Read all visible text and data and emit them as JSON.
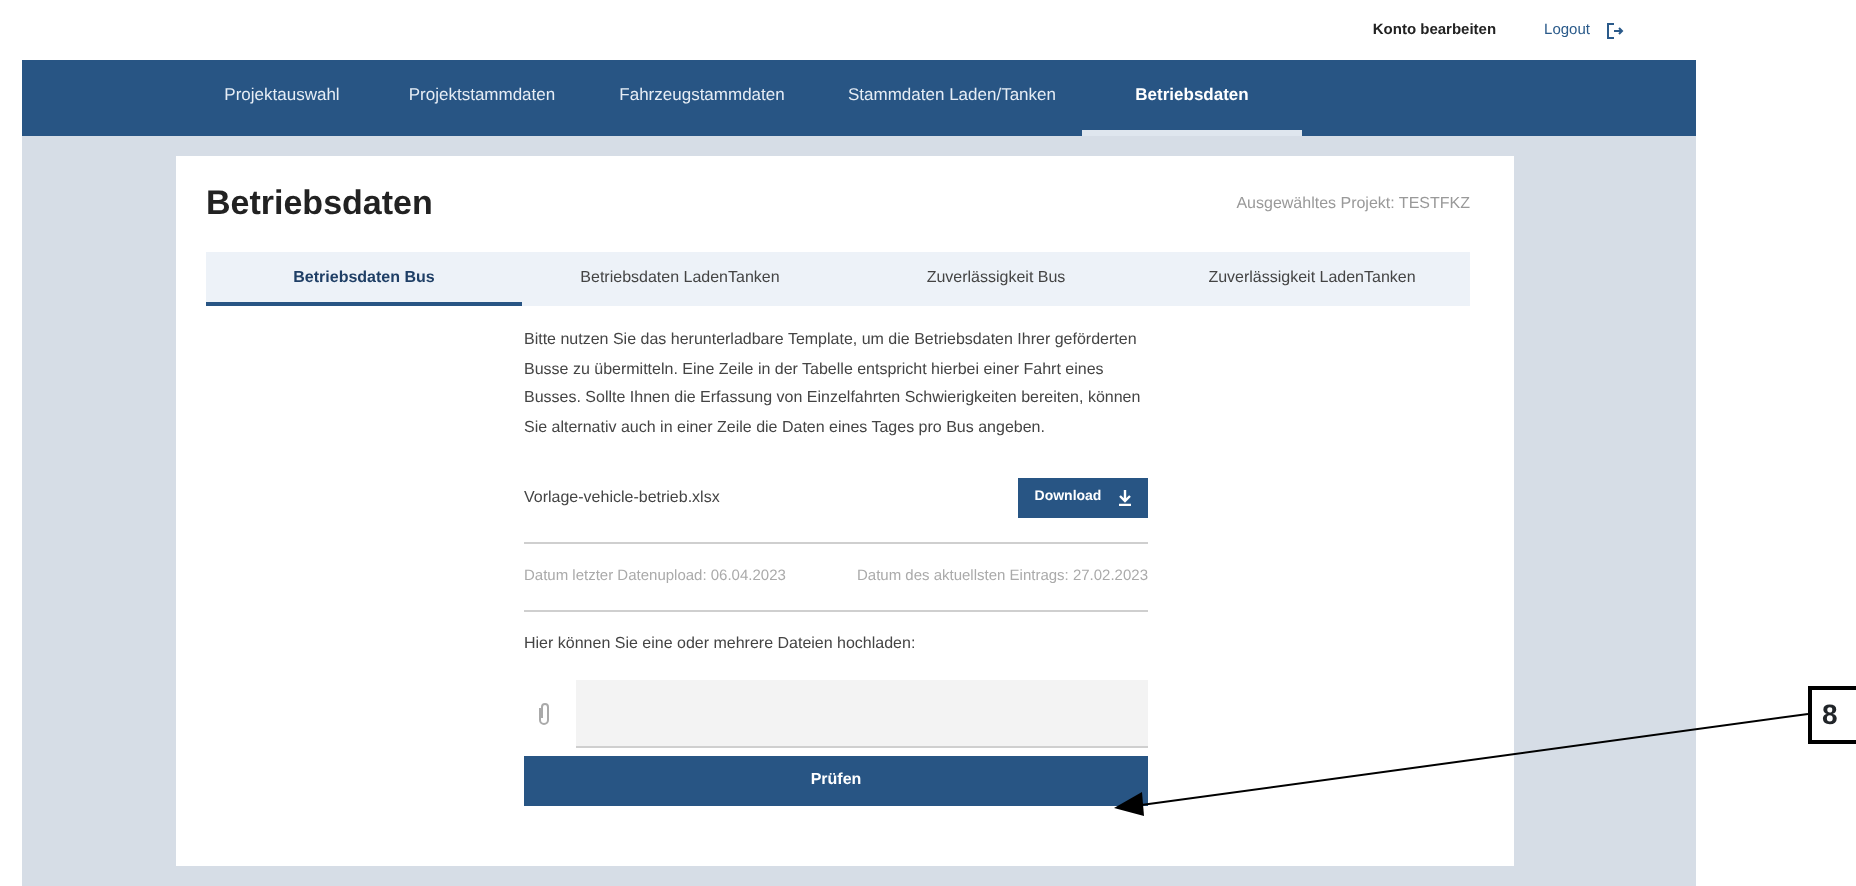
{
  "top_links": [
    {
      "label": "Konto bearbeiten",
      "kind": "account"
    },
    {
      "label": "Logout",
      "kind": "logout"
    }
  ],
  "nav": [
    {
      "label": "Projektauswahl",
      "selected": false
    },
    {
      "label": "Projektstammdaten",
      "selected": false
    },
    {
      "label": "Fahrzeugstammdaten",
      "selected": false
    },
    {
      "label": "Stammdaten Laden/Tanken",
      "selected": false
    },
    {
      "label": "Betriebsdaten",
      "selected": true
    }
  ],
  "page_title": "Betriebsdaten",
  "project_label": "Ausgewähltes Projekt: TESTFKZ",
  "tabs": [
    {
      "label": "Betriebsdaten Bus",
      "selected": true
    },
    {
      "label": "Betriebsdaten LadenTanken",
      "selected": false
    },
    {
      "label": "Zuverlässigkeit Bus",
      "selected": false
    },
    {
      "label": "Zuverlässigkeit LadenTanken",
      "selected": false
    }
  ],
  "intro": "Bitte nutzen Sie das herunterladbare Template, um die Betriebsdaten Ihrer geförderten Busse zu übermitteln. Eine Zeile in der Tabelle entspricht hierbei einer Fahrt eines Busses. Sollte Ihnen die Erfassung von Einzelfahrten Schwierigkeiten bereiten, können Sie alternativ auch in einer Zeile die Daten eines Tages pro Bus angeben.",
  "template": {
    "file": "Vorlage-vehicle-betrieb.xlsx",
    "button": "Download"
  },
  "dates": [
    "Datum letzter Datenupload: 06.04.2023",
    "Datum des aktuellsten Eintrags: 27.02.2023"
  ],
  "upload": {
    "label": "Hier können Sie eine oder mehrere Dateien hochladen:"
  },
  "submit": "Prüfen",
  "callout": "8"
}
